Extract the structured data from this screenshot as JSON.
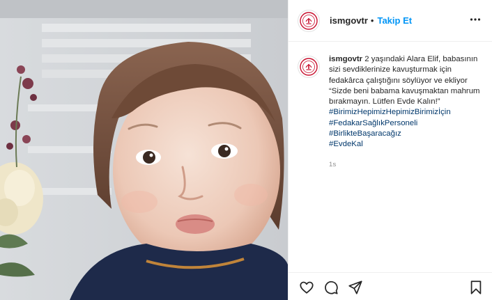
{
  "post": {
    "username": "ismgovtr",
    "separator": "•",
    "follow_label": "Takip Et",
    "caption_text": "2 yaşındaki Alara Elif, babasının sizi sevdiklerinize kavuşturmak için fedakârca çalıştığını söylüyor ve ekliyor “Sizde beni babama kavuşmaktan mahrum bırakmayın. Lütfen Evde Kalın!”",
    "hashtags": [
      "#BirimizHepimizHepimizBirimizİçin",
      "#FedakarSağlıkPersoneli",
      "#BirlikteBaşaracağız",
      "#EvdeKal"
    ],
    "timestamp": "1s"
  },
  "icons": {
    "avatar": "ministry-logo-icon",
    "more": "more-options-icon",
    "like": "heart-icon",
    "comment": "comment-icon",
    "share": "share-icon",
    "save": "bookmark-icon"
  },
  "colors": {
    "follow": "#0095f6",
    "hashtag": "#00376b",
    "timestamp": "#8e8e8e",
    "logo": "#c8102e"
  }
}
